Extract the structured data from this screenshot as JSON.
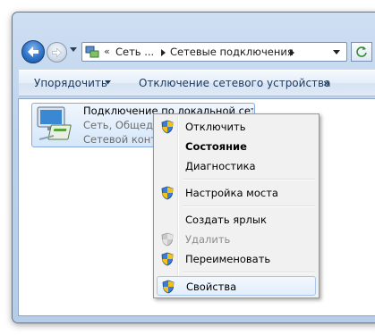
{
  "address_bar": {
    "overflow": "«",
    "segments": [
      "Сеть ...",
      "Сетевые подключения"
    ]
  },
  "command_bar": {
    "organize": "Упорядочить",
    "disable_device": "Отключение сетевого устройства",
    "more": "»"
  },
  "item": {
    "name": "Подключение по локальной сет...",
    "line2": "Сеть, Общедо",
    "line3": "Сетевой контр"
  },
  "context_menu": {
    "items": [
      {
        "label": "Отключить",
        "shield": true,
        "bold": false,
        "disabled": false
      },
      {
        "label": "Состояние",
        "shield": false,
        "bold": true,
        "disabled": false
      },
      {
        "label": "Диагностика",
        "shield": false,
        "bold": false,
        "disabled": false
      },
      {
        "label": "Настройка моста",
        "shield": true,
        "bold": false,
        "disabled": false
      },
      {
        "label": "Создать ярлык",
        "shield": false,
        "bold": false,
        "disabled": false
      },
      {
        "label": "Удалить",
        "shield": true,
        "bold": false,
        "disabled": true
      },
      {
        "label": "Переименовать",
        "shield": true,
        "bold": false,
        "disabled": false
      },
      {
        "label": "Свойства",
        "shield": true,
        "bold": false,
        "disabled": false,
        "highlighted": true
      }
    ]
  },
  "icons": {
    "back": "back-arrow-icon",
    "forward": "forward-arrow-icon",
    "network_folder": "network-connections-icon",
    "adapter": "network-adapter-icon",
    "uac_shield": "uac-shield-icon"
  },
  "colors": {
    "frame": "#bcd3ee",
    "menu_bg": "#f1f1f1",
    "highlight_border": "#a8c7ec",
    "disabled_text": "#8d8d8d"
  }
}
